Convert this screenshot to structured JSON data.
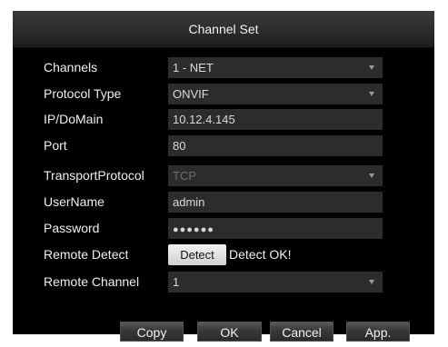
{
  "dialog": {
    "title": "Channel Set",
    "fields": {
      "channels": {
        "label": "Channels",
        "value": "1 - NET"
      },
      "protocol_type": {
        "label": "Protocol Type",
        "value": "ONVIF"
      },
      "ip_domain": {
        "label": "IP/DoMain",
        "value": "10.12.4.145"
      },
      "port": {
        "label": "Port",
        "value": "80"
      },
      "transport_protocol": {
        "label": "TransportProtocol",
        "value": "TCP"
      },
      "username": {
        "label": "UserName",
        "value": "admin"
      },
      "password": {
        "label": "Password",
        "value": "●●●●●●"
      },
      "remote_detect": {
        "label": "Remote Detect",
        "button": "Detect",
        "status": "Detect OK!"
      },
      "remote_channel": {
        "label": "Remote Channel",
        "value": "1"
      }
    },
    "buttons": {
      "copy": "Copy",
      "ok": "OK",
      "cancel": "Cancel",
      "apply": "App."
    }
  }
}
